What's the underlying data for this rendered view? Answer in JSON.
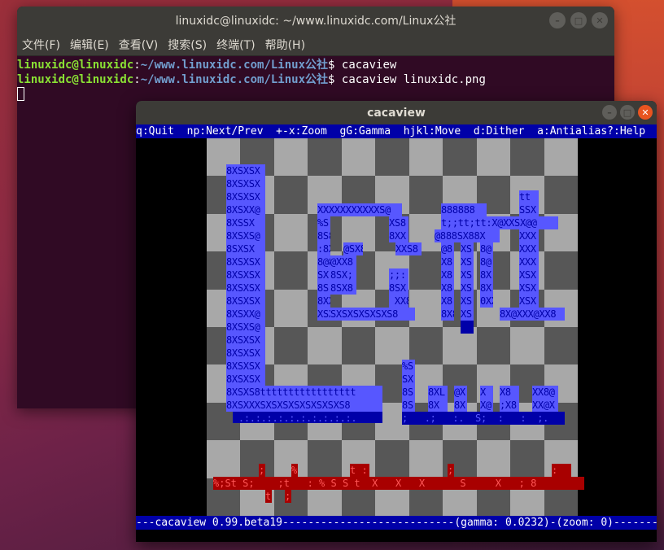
{
  "terminal": {
    "title": "linuxidc@linuxidc: ~/www.linuxidc.com/Linux公社",
    "menu": [
      "文件(F)",
      "编辑(E)",
      "查看(V)",
      "搜索(S)",
      "终端(T)",
      "帮助(H)"
    ],
    "lines": [
      {
        "user": "linuxidc@linuxidc",
        "path": "~/www.linuxidc.com/Linux公社",
        "cmd": "$ cacaview"
      },
      {
        "user": "linuxidc@linuxidc",
        "path": "~/www.linuxidc.com/Linux公社",
        "cmd": "$ cacaview linuxidc.png"
      }
    ]
  },
  "cacaview": {
    "title": "cacaview",
    "help": "q:Quit  np:Next/Prev  +-x:Zoom  gG:Gamma  hjkl:Move  d:Dither  a:Antialias?:Help",
    "status": "---cacaview 0.99.beta19---------------------------(gamma: 0.0232)-(zoom: 0)-----------"
  },
  "icons": {
    "close": "close-icon",
    "minimize": "minimize-icon",
    "maximize": "maximize-icon"
  },
  "colors": {
    "terminal_bg": "#300a24",
    "user": "#8ae234",
    "path": "#729fcf",
    "caca_blue": "#0000a8",
    "caca_lightblue": "#5757ff",
    "caca_red": "#a80000"
  }
}
